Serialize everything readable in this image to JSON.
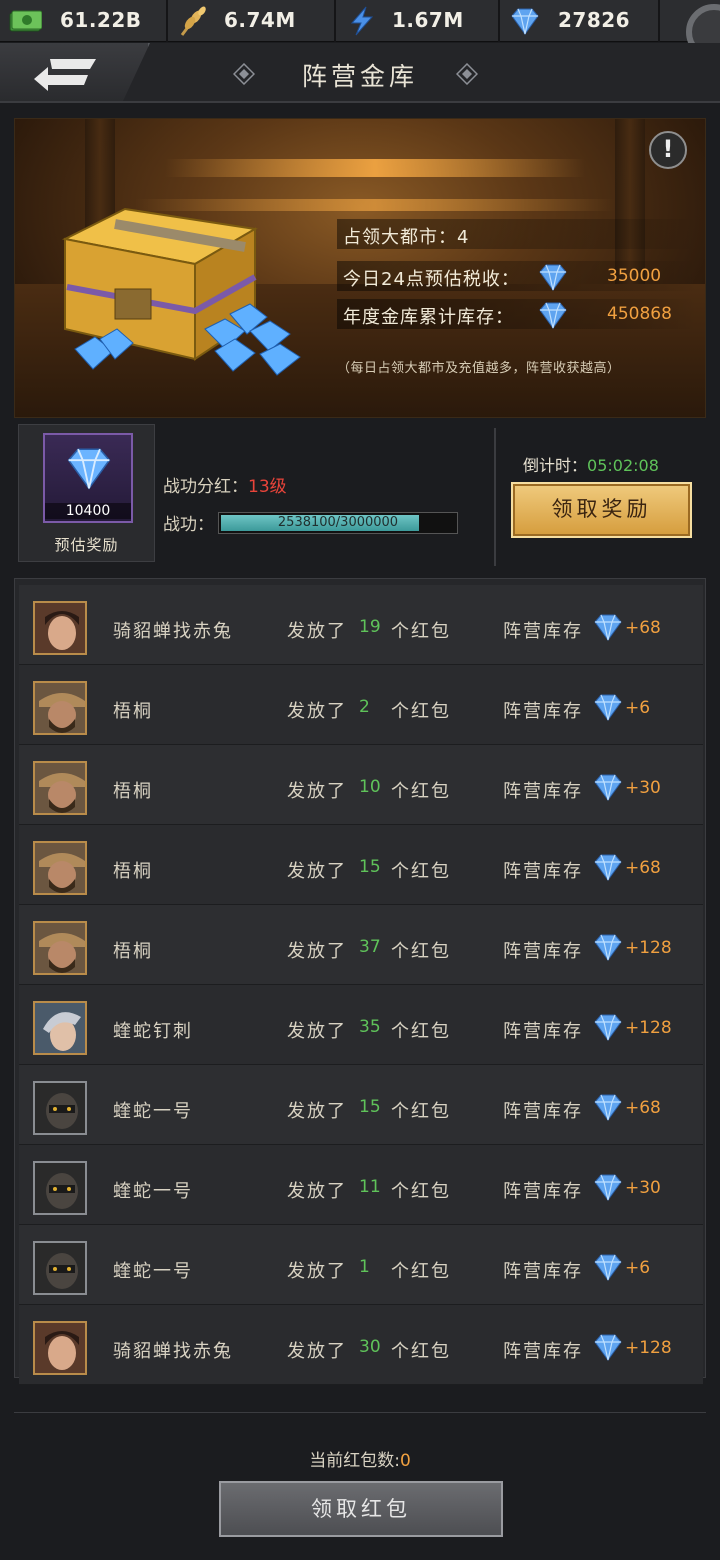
{
  "resources": [
    {
      "icon": "cash-icon",
      "value": "61.22B"
    },
    {
      "icon": "wheat-icon",
      "value": "6.74M"
    },
    {
      "icon": "energy-icon",
      "value": "1.67M"
    },
    {
      "icon": "diamond-icon",
      "value": "27826"
    }
  ],
  "header": {
    "title": "阵营金库"
  },
  "banner": {
    "cities_label": "占领大都市：4",
    "tax_label": "今日24点预估税收：",
    "tax_value": "35000",
    "stock_label": "年度金库累计库存：",
    "stock_value": "450868",
    "note": "（每日占领大都市及充值越多，阵营收获越高）"
  },
  "reward": {
    "amount": "10400",
    "caption": "预估奖励",
    "rank_label": "战功分红：",
    "rank_level": "13级",
    "power_label": "战功：",
    "power_text": "2538100/3000000",
    "power_progress": 0.846,
    "countdown_label": "倒计时：",
    "countdown_time": "05:02:08",
    "claim_label": "领取奖励"
  },
  "list": {
    "sent_label": "发放了",
    "unit_label": "个红包",
    "stock_label": "阵营库存",
    "rows": [
      {
        "name": "骑貂蝉找赤兔",
        "avatar": "young-man-portrait",
        "count": "19",
        "amount": "+68"
      },
      {
        "name": "梧桐",
        "avatar": "bearded-man-portrait",
        "count": "2",
        "amount": "+6"
      },
      {
        "name": "梧桐",
        "avatar": "bearded-man-portrait",
        "count": "10",
        "amount": "+30"
      },
      {
        "name": "梧桐",
        "avatar": "bearded-man-portrait",
        "count": "15",
        "amount": "+68"
      },
      {
        "name": "梧桐",
        "avatar": "bearded-man-portrait",
        "count": "37",
        "amount": "+128"
      },
      {
        "name": "蝰蛇钉刺",
        "avatar": "silver-hair-portrait",
        "count": "35",
        "amount": "+128"
      },
      {
        "name": "蝰蛇一号",
        "avatar": "masked-soldier-portrait",
        "count": "15",
        "amount": "+68"
      },
      {
        "name": "蝰蛇一号",
        "avatar": "masked-soldier-portrait",
        "count": "11",
        "amount": "+30"
      },
      {
        "name": "蝰蛇一号",
        "avatar": "masked-soldier-portrait",
        "count": "1",
        "amount": "+6"
      },
      {
        "name": "骑貂蝉找赤兔",
        "avatar": "young-man-portrait",
        "count": "30",
        "amount": "+128"
      }
    ]
  },
  "footer": {
    "redpacket_label": "当前红包数:",
    "redpacket_count": "0",
    "claim_redpacket_label": "领取红包"
  },
  "colors": {
    "accent_orange": "#f0a040",
    "green": "#5fc35a",
    "red": "#e8443a",
    "gold_button": "#e0b45c"
  }
}
